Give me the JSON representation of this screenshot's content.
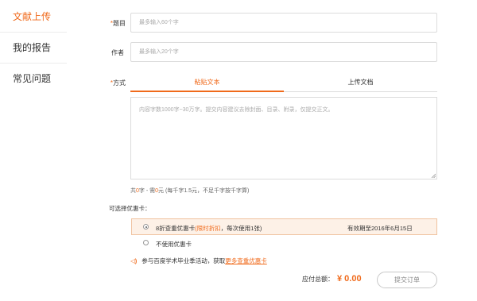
{
  "sidebar": {
    "items": [
      {
        "label": "文献上传"
      },
      {
        "label": "我的报告"
      },
      {
        "label": "常见问题"
      }
    ],
    "active_color": "#f06a1b"
  },
  "form": {
    "title_field": {
      "required_mark": "*",
      "label": "题目",
      "placeholder": "最多输入60个字"
    },
    "author_field": {
      "label": "作者",
      "placeholder": "最多输入20个字"
    },
    "method_field": {
      "required_mark": "*",
      "label": "方式"
    },
    "tabs": [
      {
        "label": "粘贴文本",
        "active": true
      },
      {
        "label": "上传文档",
        "active": false
      }
    ],
    "textarea": {
      "placeholder": "内容字数1000字~30万字。提交内容建议去除封面、目录、附录，仅提交正文。"
    },
    "count": {
      "prefix": "共",
      "chars": "0",
      "mid": "字 - 需",
      "price": "0",
      "suffix": "元 (每千字1.5元，不足千字按千字算)"
    }
  },
  "coupons": {
    "title": "可选择优惠卡：",
    "options": [
      {
        "main": "8折查重优惠卡",
        "highlight": "(限时折扣",
        "rest": "，每次使用1张)",
        "validity": "有效期至2016年6月15日",
        "selected": true
      },
      {
        "main": "不使用优惠卡",
        "selected": false
      }
    ]
  },
  "promo": {
    "icon": "◁)",
    "text": "参与百度学术毕业季活动，获取",
    "link": "更多查重优惠卡"
  },
  "footer": {
    "total_label": "应付总额：",
    "total_amount": "¥ 0.00",
    "submit_label": "提交订单"
  }
}
